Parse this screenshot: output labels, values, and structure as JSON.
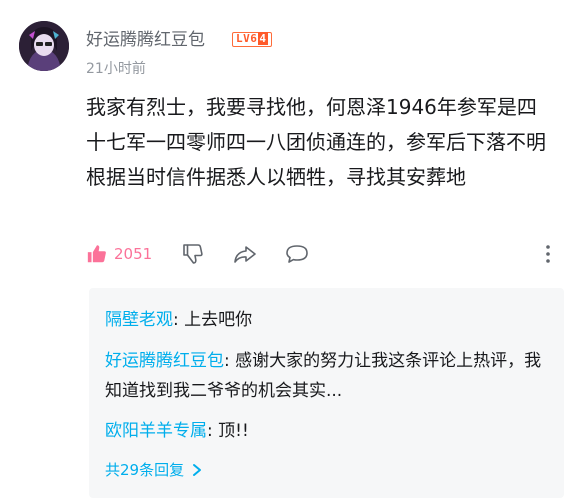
{
  "comment": {
    "username": "好运腾腾红豆包",
    "level_badge": "LV6",
    "level_suffix": "4",
    "time": "21小时前",
    "text": "我家有烈士，我要寻找他，何恩泽1946年参军是四十七军一四零师四一八团侦通连的，参军后下落不明根据当时信件据悉人以牺牲，寻找其安葬地",
    "like_count": "2051",
    "colors": {
      "like": "#fb7299",
      "link": "#00aeec",
      "badge": "#ff5a2a"
    },
    "icons": [
      "thumbs-up-icon",
      "thumbs-down-icon",
      "share-icon",
      "reply-icon",
      "more-vertical-icon"
    ]
  },
  "replies": {
    "items": [
      {
        "name": "隔壁老观",
        "separator": ": ",
        "text": "上去吧你"
      },
      {
        "name": "好运腾腾红豆包",
        "separator": ": ",
        "text": "感谢大家的努力让我这条评论上热评，我知道找到我二爷爷的机会其实..."
      },
      {
        "name": "欧阳羊羊专属",
        "separator": ": ",
        "text": "顶!!"
      }
    ],
    "view_more": "共29条回复"
  }
}
